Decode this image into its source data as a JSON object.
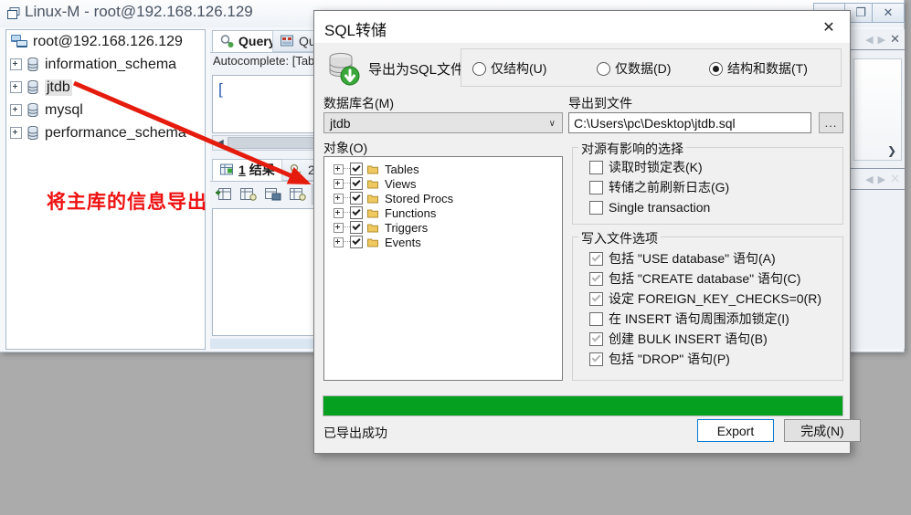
{
  "background_window": {
    "title": "Linux-M - root@192.168.126.129",
    "title_icon": "windows-restore-icon",
    "window_buttons": [
      {
        "name": "minimize",
        "glyph": "—"
      },
      {
        "name": "maximize",
        "glyph": "❐"
      },
      {
        "name": "close",
        "glyph": "✕"
      }
    ],
    "db_tree": {
      "root": {
        "label": "root@192.168.126.129",
        "icon": "server-icon"
      },
      "items": [
        {
          "label": "information_schema",
          "icon": "database-icon",
          "highlighted": false
        },
        {
          "label": "jtdb",
          "icon": "database-icon",
          "highlighted": true
        },
        {
          "label": "mysql",
          "icon": "database-icon",
          "highlighted": false
        },
        {
          "label": "performance_schema",
          "icon": "database-icon",
          "highlighted": false
        }
      ]
    },
    "tabs": [
      {
        "label": "Query",
        "active": true,
        "icon": "query-icon"
      },
      {
        "label": "Que",
        "active": false,
        "icon": "query-builder-icon"
      }
    ],
    "autocomplete_hint": "Autocomplete: [Tab",
    "result_tab": {
      "number": "1",
      "label": "结果"
    },
    "result_tab2_label": "2",
    "annotation": {
      "text": "将主库的信息导出",
      "color": "#ee1111",
      "arrow_color": "#e41b0d"
    }
  },
  "dialog": {
    "title": "SQL转储",
    "close_glyph": "✕",
    "icon": "database-export-icon",
    "export_label": "导出为SQL文件",
    "mode_options": [
      {
        "label": "仅结构(U)",
        "checked": false
      },
      {
        "label": "仅数据(D)",
        "checked": false
      },
      {
        "label": "结构和数据(T)",
        "checked": true
      }
    ],
    "dbname": {
      "label": "数据库名(M)",
      "value": "jtdb",
      "arrow_glyph": "∨"
    },
    "outfile": {
      "label": "导出到文件",
      "value": "C:\\Users\\pc\\Desktop\\jtdb.sql",
      "browse_label": "..."
    },
    "objects": {
      "label": "对象(O)",
      "items": [
        {
          "label": "Tables",
          "checked": true
        },
        {
          "label": "Views",
          "checked": true
        },
        {
          "label": "Stored Procs",
          "checked": true
        },
        {
          "label": "Functions",
          "checked": true
        },
        {
          "label": "Triggers",
          "checked": true
        },
        {
          "label": "Events",
          "checked": true
        }
      ]
    },
    "source_group": {
      "title": "对源有影响的选择",
      "items": [
        {
          "label": "读取时锁定表(K)",
          "checked": false
        },
        {
          "label": "转储之前刷新日志(G)",
          "checked": false
        },
        {
          "label": "Single transaction",
          "checked": false
        }
      ]
    },
    "write_group": {
      "title": "写入文件选项",
      "items": [
        {
          "label": "包括 \"USE database\" 语句(A)",
          "checked": true
        },
        {
          "label": "包括 \"CREATE database\" 语句(C)",
          "checked": true
        },
        {
          "label": "设定 FOREIGN_KEY_CHECKS=0(R)",
          "checked": true
        },
        {
          "label": "在 INSERT 语句周围添加锁定(I)",
          "checked": false
        },
        {
          "label": "创建 BULK INSERT 语句(B)",
          "checked": true
        },
        {
          "label": "包括 \"DROP\" 语句(P)",
          "checked": true
        }
      ]
    },
    "progress": {
      "percent": 100,
      "color": "#06a021"
    },
    "status_text": "已导出成功",
    "buttons": {
      "export": "Export",
      "finish": "完成(N)"
    }
  }
}
